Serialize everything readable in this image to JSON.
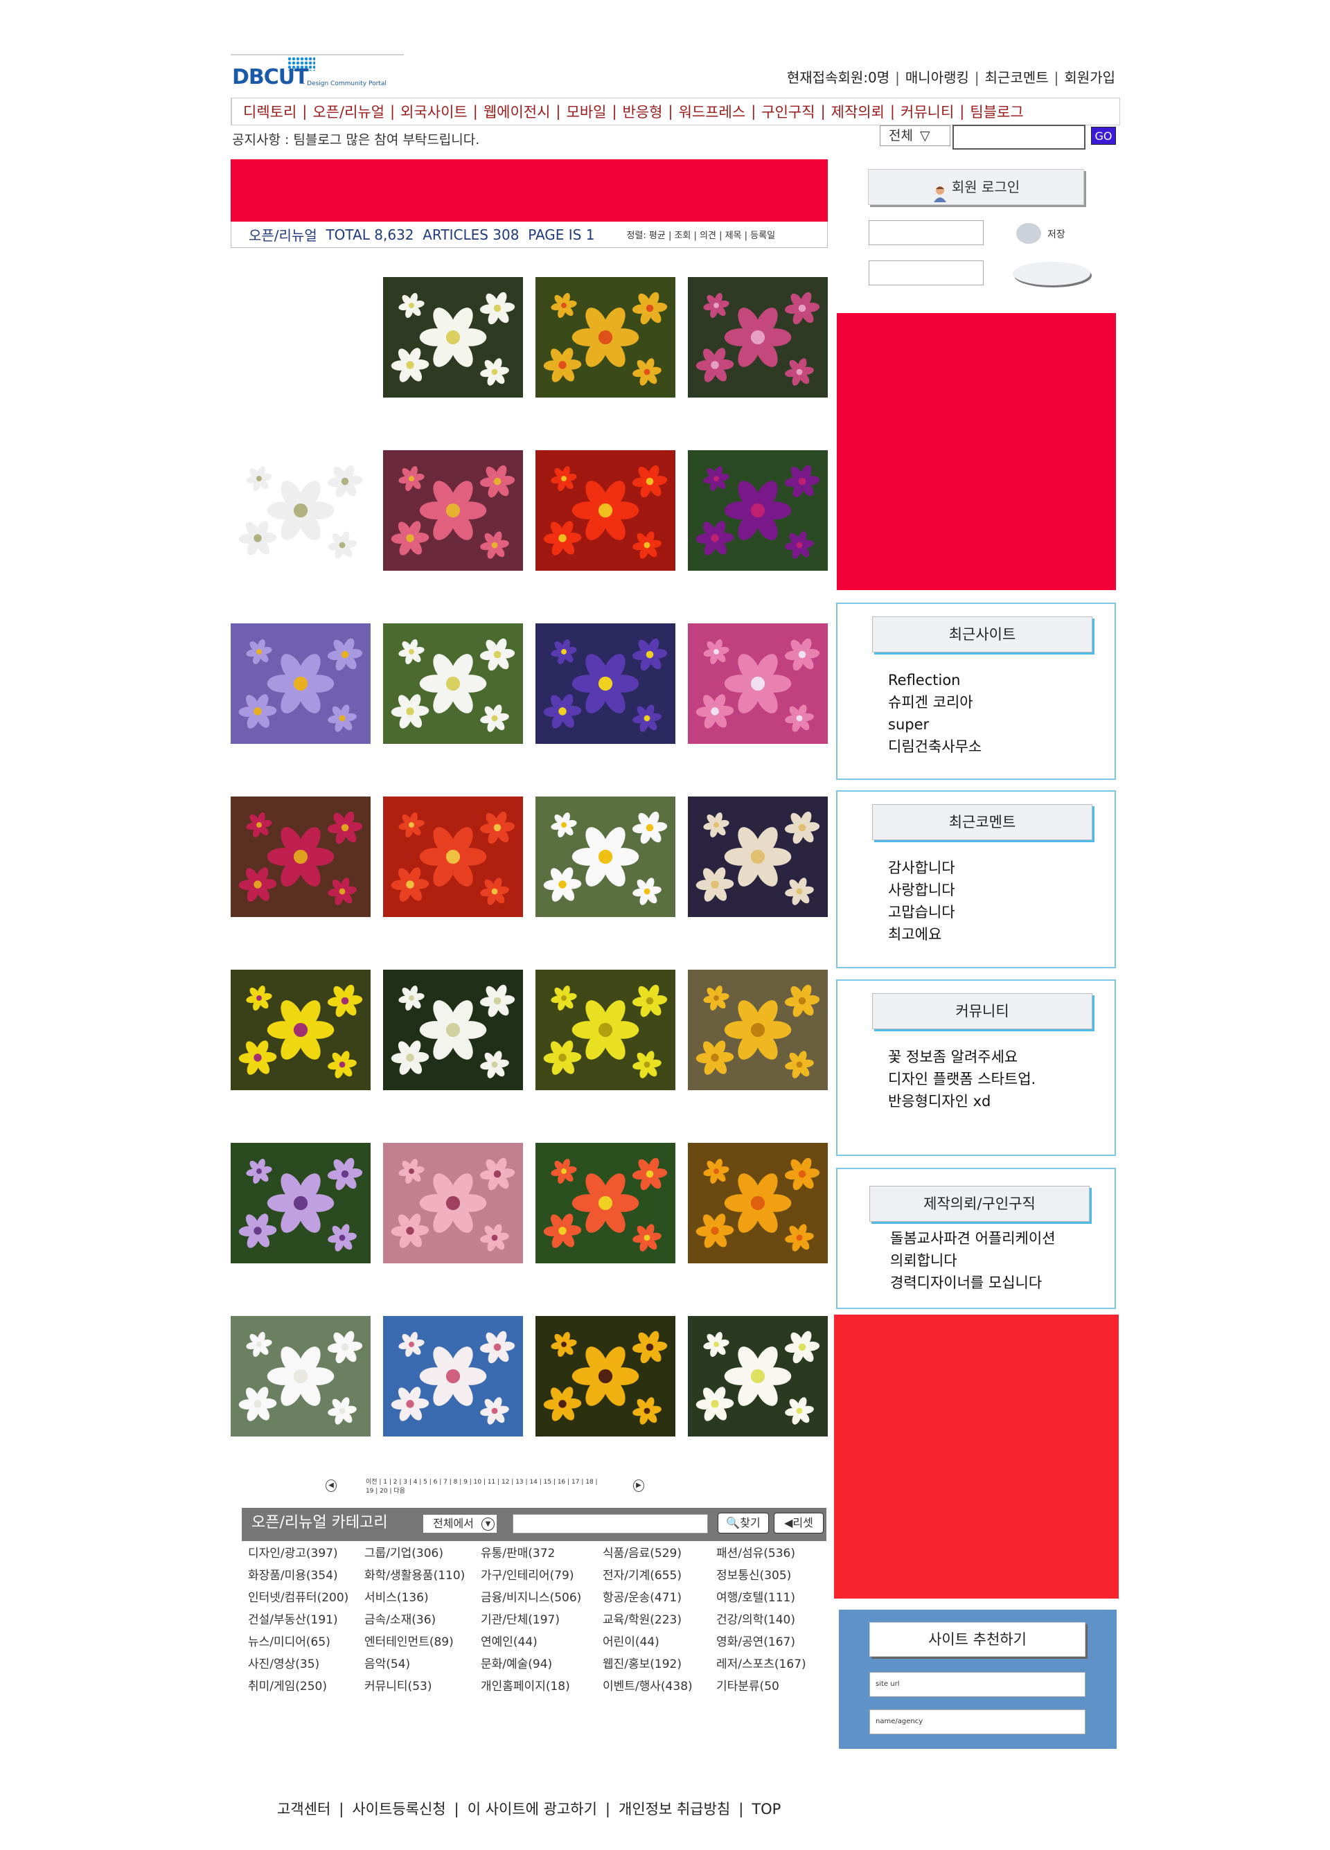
{
  "header": {
    "logo": "DBCUT",
    "logo_sub": "- Design Community Portal",
    "toplinks": [
      "현재접속회원:0명",
      "매니아랭킹",
      "최근코멘트",
      "회원가입"
    ]
  },
  "gnb": [
    "디렉토리",
    "오픈/리뉴얼",
    "외국사이트",
    "웹에이전시",
    "모바일",
    "반응형",
    "워드프레스",
    "구인구직",
    "제작의뢰",
    "커뮤니티",
    "팀블로그"
  ],
  "notice": "공지사항 : 팀블로그 많은 참여 부탁드립니다.",
  "search": {
    "select": "전체",
    "arrow": "▽",
    "go": "GO"
  },
  "board": {
    "title": "오픈/리뉴얼",
    "total": "TOTAL 8,632",
    "articles": "ARTICLES  308",
    "page": "PAGE IS  1",
    "sort": "정렬: 평균 | 조회 | 의견 | 제목 | 등록일"
  },
  "colors": {
    "banner": "#f40038",
    "widget_border": "#7cc6e8",
    "recommend_bg": "#5f92c6",
    "go_button": "#3b1bd6",
    "menu_text": "#9b1b1b"
  },
  "gallery": [
    {
      "icon": "white-lily-flowers-icon",
      "bg": "#2e3a22",
      "petal": "#f4f6ee",
      "center": "#d9d060"
    },
    {
      "icon": "yellow-orange-flowers-icon",
      "bg": "#3a4a18",
      "petal": "#e8b020",
      "center": "#e0501a"
    },
    {
      "icon": "pink-clover-flower-icon",
      "bg": "#2f3a24",
      "petal": "#c4487c",
      "center": "#e6a0c0"
    },
    {
      "icon": "white-star-flower-icon",
      "bg": "#ffffff",
      "petal": "#eeeeee",
      "center": "#b0b080"
    },
    {
      "icon": "pink-daisies-icon",
      "bg": "#6a2a3c",
      "petal": "#e0607e",
      "center": "#e6b030"
    },
    {
      "icon": "red-primrose-icon",
      "bg": "#a01810",
      "petal": "#f03010",
      "center": "#f0c020"
    },
    {
      "icon": "purple-fuchsia-icon",
      "bg": "#2a4a24",
      "petal": "#7a1a8a",
      "center": "#c02070"
    },
    {
      "icon": "lavender-flower-icon",
      "bg": "#7060b0",
      "petal": "#a898e0",
      "center": "#e8b020"
    },
    {
      "icon": "small-white-flowers-icon",
      "bg": "#4a6a30",
      "petal": "#f4f4f0",
      "center": "#d8d060"
    },
    {
      "icon": "purple-pansies-icon",
      "bg": "#2a2a60",
      "petal": "#5a3ab0",
      "center": "#f0d020"
    },
    {
      "icon": "pink-blossoms-icon",
      "bg": "#c04080",
      "petal": "#e880b0",
      "center": "#f0e0f0"
    },
    {
      "icon": "magenta-daisies-icon",
      "bg": "#5a3020",
      "petal": "#c02050",
      "center": "#e0a020"
    },
    {
      "icon": "red-quince-flowers-icon",
      "bg": "#b02010",
      "petal": "#e84020",
      "center": "#f0c040"
    },
    {
      "icon": "white-daisy-icon",
      "bg": "#5a7040",
      "petal": "#f8f8f8",
      "center": "#f0c010"
    },
    {
      "icon": "pale-flowers-dark-icon",
      "bg": "#2a2440",
      "petal": "#e8dcc8",
      "center": "#e0c070"
    },
    {
      "icon": "yellow-pansies-icon",
      "bg": "#3a4018",
      "petal": "#f0d810",
      "center": "#a03070"
    },
    {
      "icon": "white-cardamine-icon",
      "bg": "#203018",
      "petal": "#f4f4ee",
      "center": "#d0d0a0"
    },
    {
      "icon": "yellow-chrysanthemum-icon",
      "bg": "#404818",
      "petal": "#e8e020",
      "center": "#b0a010"
    },
    {
      "icon": "yellow-allium-icon",
      "bg": "#6a6040",
      "petal": "#f0b820",
      "center": "#c08010"
    },
    {
      "icon": "purple-osteospermum-icon",
      "bg": "#2a4a20",
      "petal": "#c0a0e0",
      "center": "#6a3a8a"
    },
    {
      "icon": "pink-cherry-blossoms-icon",
      "bg": "#c08090",
      "petal": "#f0b0c0",
      "center": "#a04060"
    },
    {
      "icon": "orange-star-flower-icon",
      "bg": "#2a5020",
      "petal": "#f05830",
      "center": "#f0d020"
    },
    {
      "icon": "yellow-flowers-butterfly-icon",
      "bg": "#6a4a10",
      "petal": "#f0a010",
      "center": "#e06010"
    },
    {
      "icon": "babys-breath-icon",
      "bg": "#6a8060",
      "petal": "#f8f8f8",
      "center": "#e8e8e0"
    },
    {
      "icon": "white-cherry-blossoms-icon",
      "bg": "#3a6ab0",
      "petal": "#f4eef0",
      "center": "#d06080"
    },
    {
      "icon": "black-eyed-susan-icon",
      "bg": "#2a3010",
      "petal": "#f0b010",
      "center": "#502010"
    },
    {
      "icon": "white-jasmine-icon",
      "bg": "#2a3a20",
      "petal": "#f8f8f0",
      "center": "#e0e060"
    }
  ],
  "pager": {
    "prev": "◀",
    "next": "▶",
    "pages": "이전 | 1 | 2 | 3 | 4 | 5 | 6 | 7 | 8 | 9 | 10 | 11 | 12 | 13 | 14 | 15 | 16 | 17 | 18 | 19 | 20 |  다음"
  },
  "category": {
    "title": "오픈/리뉴얼 카테고리",
    "select": "전체에서",
    "find_btn": "찾기",
    "reset_btn": "리셋",
    "items": [
      "디자인/광고(397)",
      "그룹/기업(306)",
      "유통/판매(372",
      "식품/음료(529)",
      "패션/섬유(536)",
      "화장품/미용(354)",
      "화학/생활용품(110)",
      "가구/인테리어(79)",
      "전자/기계(655)",
      "정보통신(305)",
      "인터넷/컴퓨터(200)",
      "서비스(136)",
      "금융/비지니스(506)",
      "항공/운송(471)",
      "여행/호텔(111)",
      "건설/부동산(191)",
      "금속/소재(36)",
      "기관/단체(197)",
      "교육/학원(223)",
      "건강/의학(140)",
      "뉴스/미디어(65)",
      "엔터테인먼트(89)",
      "연예인(44)",
      "어린이(44)",
      "영화/공연(167)",
      "사진/영상(35)",
      "음악(54)",
      "문화/예술(94)",
      "웹진/홍보(192)",
      "레저/스포츠(167)",
      "취미/게임(250)",
      "커뮤니티(53)",
      "개인홈페이지(18)",
      "이벤트/행사(438)",
      "기타분류(50"
    ]
  },
  "sidebar": {
    "login_label": "회원 로그인",
    "save_label": "저장",
    "widgets": [
      {
        "title": "최근사이트",
        "items": [
          "Reflection",
          "슈피겐 코리아",
          "super",
          "디림건축사무소"
        ]
      },
      {
        "title": "최근코멘트",
        "items": [
          "감사합니다",
          "사랑합니다",
          "고맙습니다",
          "최고에요"
        ]
      },
      {
        "title": "커뮤니티",
        "items": [
          "꽃 정보좀 알려주세요",
          "디자인 플랫폼 스타트업.",
          "반응형디자인 xd"
        ]
      },
      {
        "title": "제작의뢰/구인구직",
        "items": [
          "돌봄교사파견 어플리케이션",
          "의뢰합니다",
          "경력디자이너를 모십니다"
        ]
      }
    ],
    "recommend": {
      "title": "사이트 추천하기",
      "url_placeholder": "site url",
      "name_placeholder": "name/agency"
    }
  },
  "footer": [
    "고객센터",
    "사이트등록신청",
    "이 사이트에 광고하기",
    "개인정보 취급방침",
    "TOP"
  ]
}
